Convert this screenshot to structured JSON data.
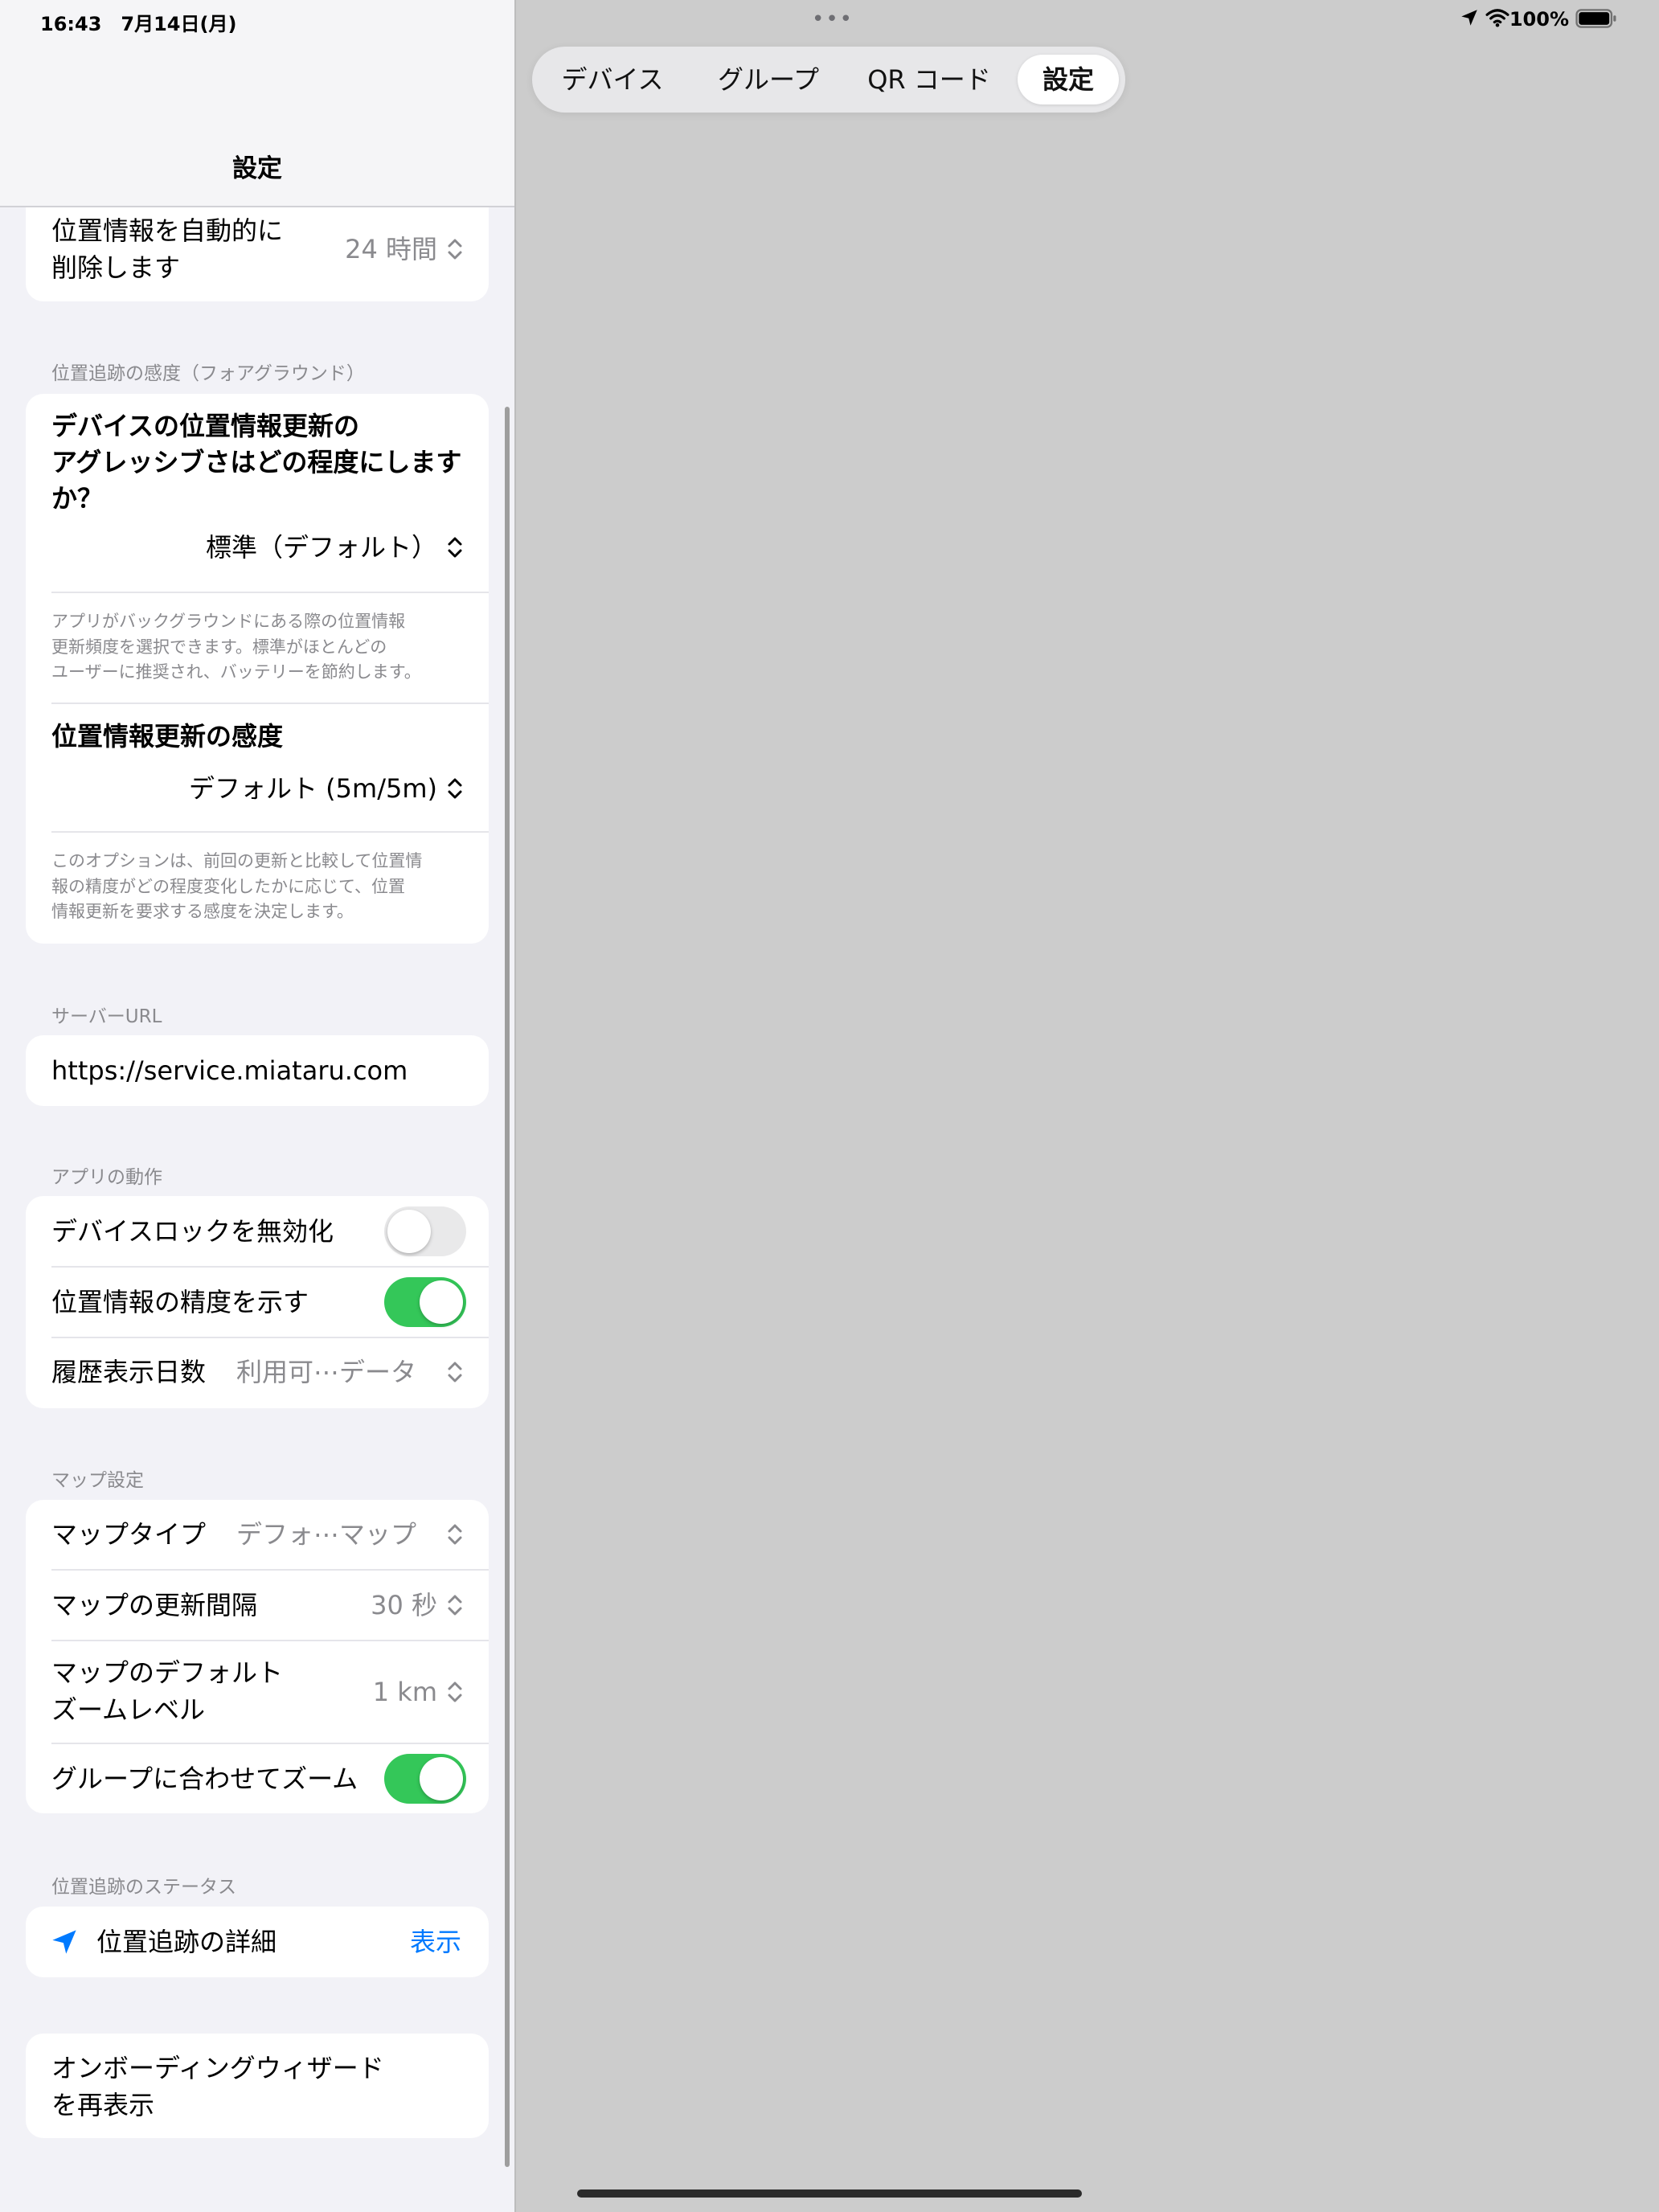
{
  "status_bar": {
    "time_date": "16:43　7月14日(月)",
    "battery_percent": "100%",
    "icons": [
      "location-arrow-icon",
      "wifi-icon",
      "battery-icon"
    ]
  },
  "sidebar": {
    "title": "設定",
    "auto_delete": {
      "label_line1": "位置情報を自動的に",
      "label_line2": "削除します",
      "value": "24 時間"
    },
    "foreground_section": {
      "header": "位置追跡の感度（フォアグラウンド）",
      "question_line1": "デバイスの位置情報更新の",
      "question_line2": "アグレッシブさはどの程度にします",
      "question_line3": "か？",
      "question_value": "標準（デフォルト）",
      "footnote_line1": "アプリがバックグラウンドにある際の位置情報",
      "footnote_line2": "更新頻度を選択できます。標準がほとんどの",
      "footnote_line3": "ユーザーに推奨され、バッテリーを節約します。",
      "sensitivity_label": "位置情報更新の感度",
      "sensitivity_value": "デフォルト (5m/5m)",
      "footnote2_line1": "このオプションは、前回の更新と比較して位置情",
      "footnote2_line2": "報の精度がどの程度変化したかに応じて、位置",
      "footnote2_line3": "情報更新を要求する感度を決定します。"
    },
    "server_section": {
      "header": "サーバーURL",
      "url": "https://service.miataru.com"
    },
    "app_section": {
      "header": "アプリの動作",
      "disable_lock_label": "デバイスロックを無効化",
      "disable_lock_on": false,
      "show_accuracy_label": "位置情報の精度を示す",
      "show_accuracy_on": true,
      "history_days_label": "履歴表示日数",
      "history_days_value": "利用可⋯データ"
    },
    "map_section": {
      "header": "マップ設定",
      "map_type_label": "マップタイプ",
      "map_type_value": "デフォ⋯マップ",
      "refresh_label": "マップの更新間隔",
      "refresh_value": "30 秒",
      "zoom_label_line1": "マップのデフォルト",
      "zoom_label_line2": "ズームレベル",
      "zoom_value": "1 km",
      "group_zoom_label": "グループに合わせてズーム",
      "group_zoom_on": true
    },
    "status_section": {
      "header": "位置追跡のステータス",
      "detail_label": "位置追跡の詳細",
      "detail_action": "表示"
    },
    "onboarding": {
      "line1": "オンボーディングウィザード",
      "line2": "を再表示"
    }
  },
  "tabs": [
    "デバイス",
    "グループ",
    "QR コード",
    "設定"
  ],
  "active_tab": "設定",
  "colors": {
    "accent": "#007aff",
    "toggle_on": "#34c759",
    "background": "#cccccc"
  }
}
